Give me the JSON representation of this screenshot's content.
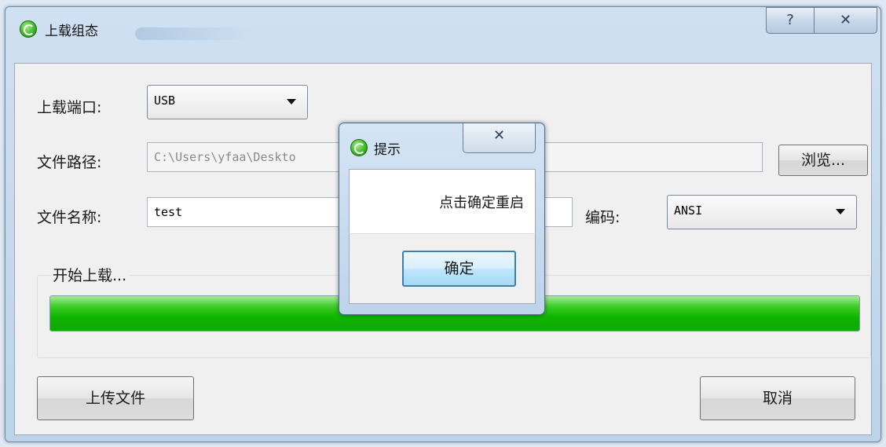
{
  "window": {
    "title": "上载组态",
    "help_glyph": "?",
    "close_glyph": "✕"
  },
  "form": {
    "port_label": "上载端口:",
    "port_value": "USB",
    "path_label": "文件路径:",
    "path_value": "C:\\Users\\yfaa\\Deskto",
    "browse_label": "浏览...",
    "name_label": "文件名称:",
    "name_value": "test",
    "encoding_label": "编码:",
    "encoding_value": "ANSI"
  },
  "progress": {
    "group_title": "开始上载...",
    "value_percent": 100,
    "fill_color": "#13b800"
  },
  "buttons": {
    "upload": "上传文件",
    "cancel": "取消"
  },
  "dialog": {
    "title": "提示",
    "close_glyph": "✕",
    "message": "点击确定重启",
    "ok": "确定"
  }
}
